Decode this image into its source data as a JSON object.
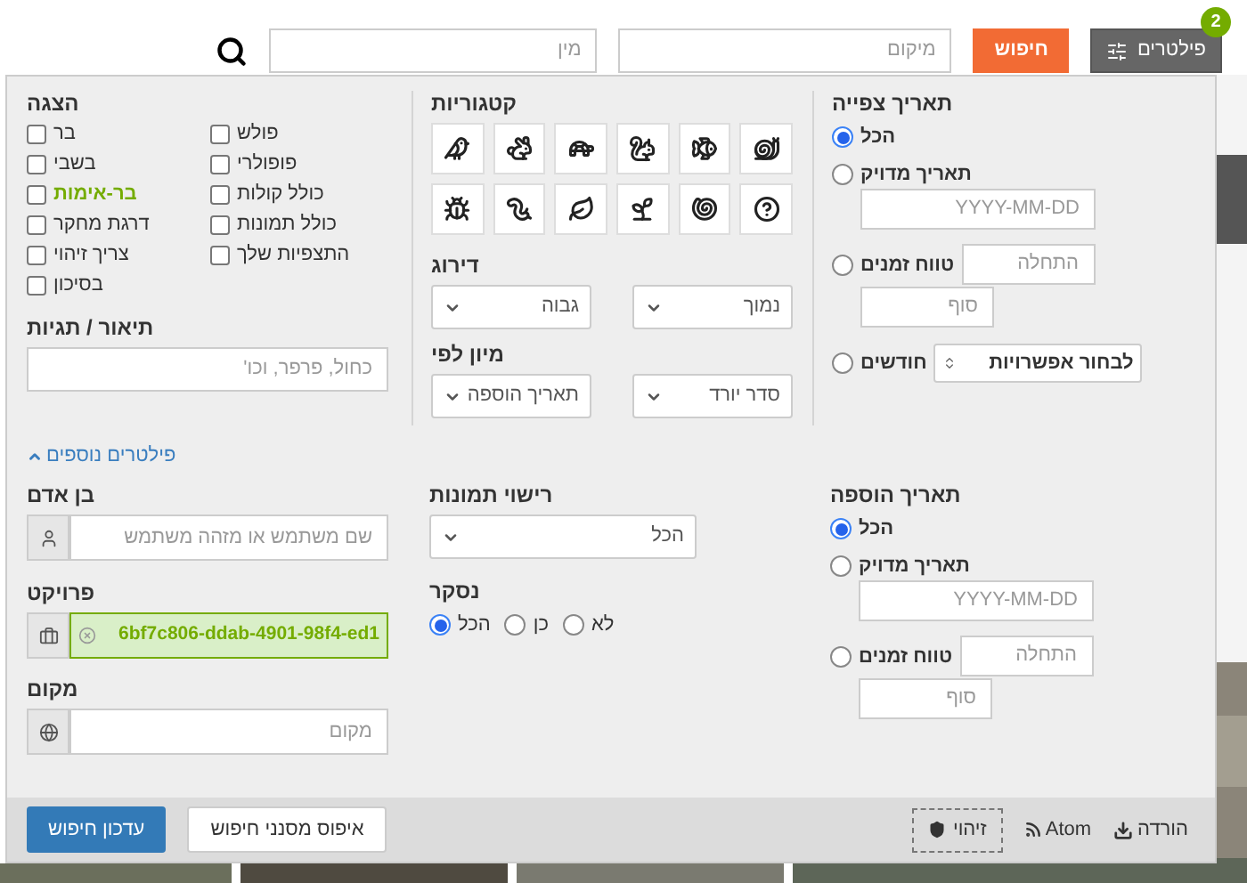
{
  "top_bar": {
    "filters_button": {
      "label": "פילטרים",
      "badge": "2"
    },
    "search_button": "חיפוש",
    "place_field": {
      "placeholder": "מיקום"
    },
    "species_field": {
      "placeholder": "מין"
    }
  },
  "display": {
    "title": "הצגה",
    "columns": [
      [
        {
          "label": "פולש",
          "checked": false,
          "highlighted": false
        },
        {
          "label": "פופולרי",
          "checked": false,
          "highlighted": false
        },
        {
          "label": "כולל קולות",
          "checked": false,
          "highlighted": false
        },
        {
          "label": "כולל תמונות",
          "checked": false,
          "highlighted": false
        },
        {
          "label": "התצפיות שלך",
          "checked": false,
          "highlighted": false
        }
      ],
      [
        {
          "label": "בר",
          "checked": false,
          "highlighted": false
        },
        {
          "label": "בשבי",
          "checked": false,
          "highlighted": false
        },
        {
          "label": "בר-אימות",
          "checked": false,
          "highlighted": true
        },
        {
          "label": "דרגת מחקר",
          "checked": false,
          "highlighted": false
        },
        {
          "label": "צריך זיהוי",
          "checked": false,
          "highlighted": false
        },
        {
          "label": "בסיכון",
          "checked": false,
          "highlighted": false
        }
      ]
    ]
  },
  "description": {
    "title": "תיאור / תגיות",
    "placeholder": "כחול, פרפר, וכו'"
  },
  "categories": {
    "title": "קטגוריות",
    "items": [
      {
        "selected": false
      },
      {
        "selected": false
      },
      {
        "selected": false
      },
      {
        "selected": false
      },
      {
        "selected": false
      },
      {
        "selected": false
      },
      {
        "selected": false
      },
      {
        "selected": false
      },
      {
        "selected": false
      },
      {
        "selected": false
      },
      {
        "selected": false
      },
      {
        "selected": false
      }
    ]
  },
  "rating": {
    "title": "דירוג",
    "selects": [
      "נמוך",
      "גבוה"
    ]
  },
  "sort": {
    "title": "מיון לפי",
    "selects": [
      "סדר יורד",
      "תאריך הוספה"
    ]
  },
  "observed_date": {
    "title": "תאריך צפייה",
    "options": [
      {
        "kind": "any",
        "label": "הכל",
        "selected": true
      },
      {
        "kind": "exact",
        "label": "תאריך מדויק",
        "selected": false,
        "placeholder": "YYYY-MM-DD"
      },
      {
        "kind": "range",
        "label": "טווח זמנים",
        "selected": false,
        "start_placeholder": "התחלה",
        "end_placeholder": "סוף"
      },
      {
        "kind": "months",
        "label": "חודשים",
        "selected": false,
        "select": "לבחור אפשרויות"
      }
    ]
  },
  "more_filters_link": "פילטרים נוספים",
  "person": {
    "title": "בן אדם",
    "placeholder": "שם משתמש או מזהה משתמש"
  },
  "project": {
    "title": "פרויקט",
    "value": "6bf7c806-ddab-4901-98f4-ed1"
  },
  "place": {
    "title": "מקום",
    "placeholder": "מקום"
  },
  "photo_license": {
    "title": "רישוי תמונות",
    "value": "הכל"
  },
  "reviewed": {
    "title": "נסקר",
    "options": [
      {
        "label": "לא",
        "selected": false
      },
      {
        "label": "כן",
        "selected": false
      },
      {
        "label": "הכל",
        "selected": true
      }
    ]
  },
  "added_date": {
    "title": "תאריך הוספה",
    "options": [
      {
        "kind": "any",
        "label": "הכל",
        "selected": true
      },
      {
        "kind": "exact",
        "label": "תאריך מדויק",
        "selected": false,
        "placeholder": "YYYY-MM-DD"
      },
      {
        "kind": "range",
        "label": "טווח זמנים",
        "selected": false,
        "start_placeholder": "התחלה",
        "end_placeholder": "סוף"
      }
    ]
  },
  "footer": {
    "update_button": "עדכון חיפוש",
    "reset_button": "איפוס מסנני חיפוש",
    "links": [
      {
        "kind": "download",
        "label": "הורדה"
      },
      {
        "kind": "atom",
        "label": "Atom"
      },
      {
        "kind": "identify",
        "label": "זיהוי"
      }
    ]
  }
}
